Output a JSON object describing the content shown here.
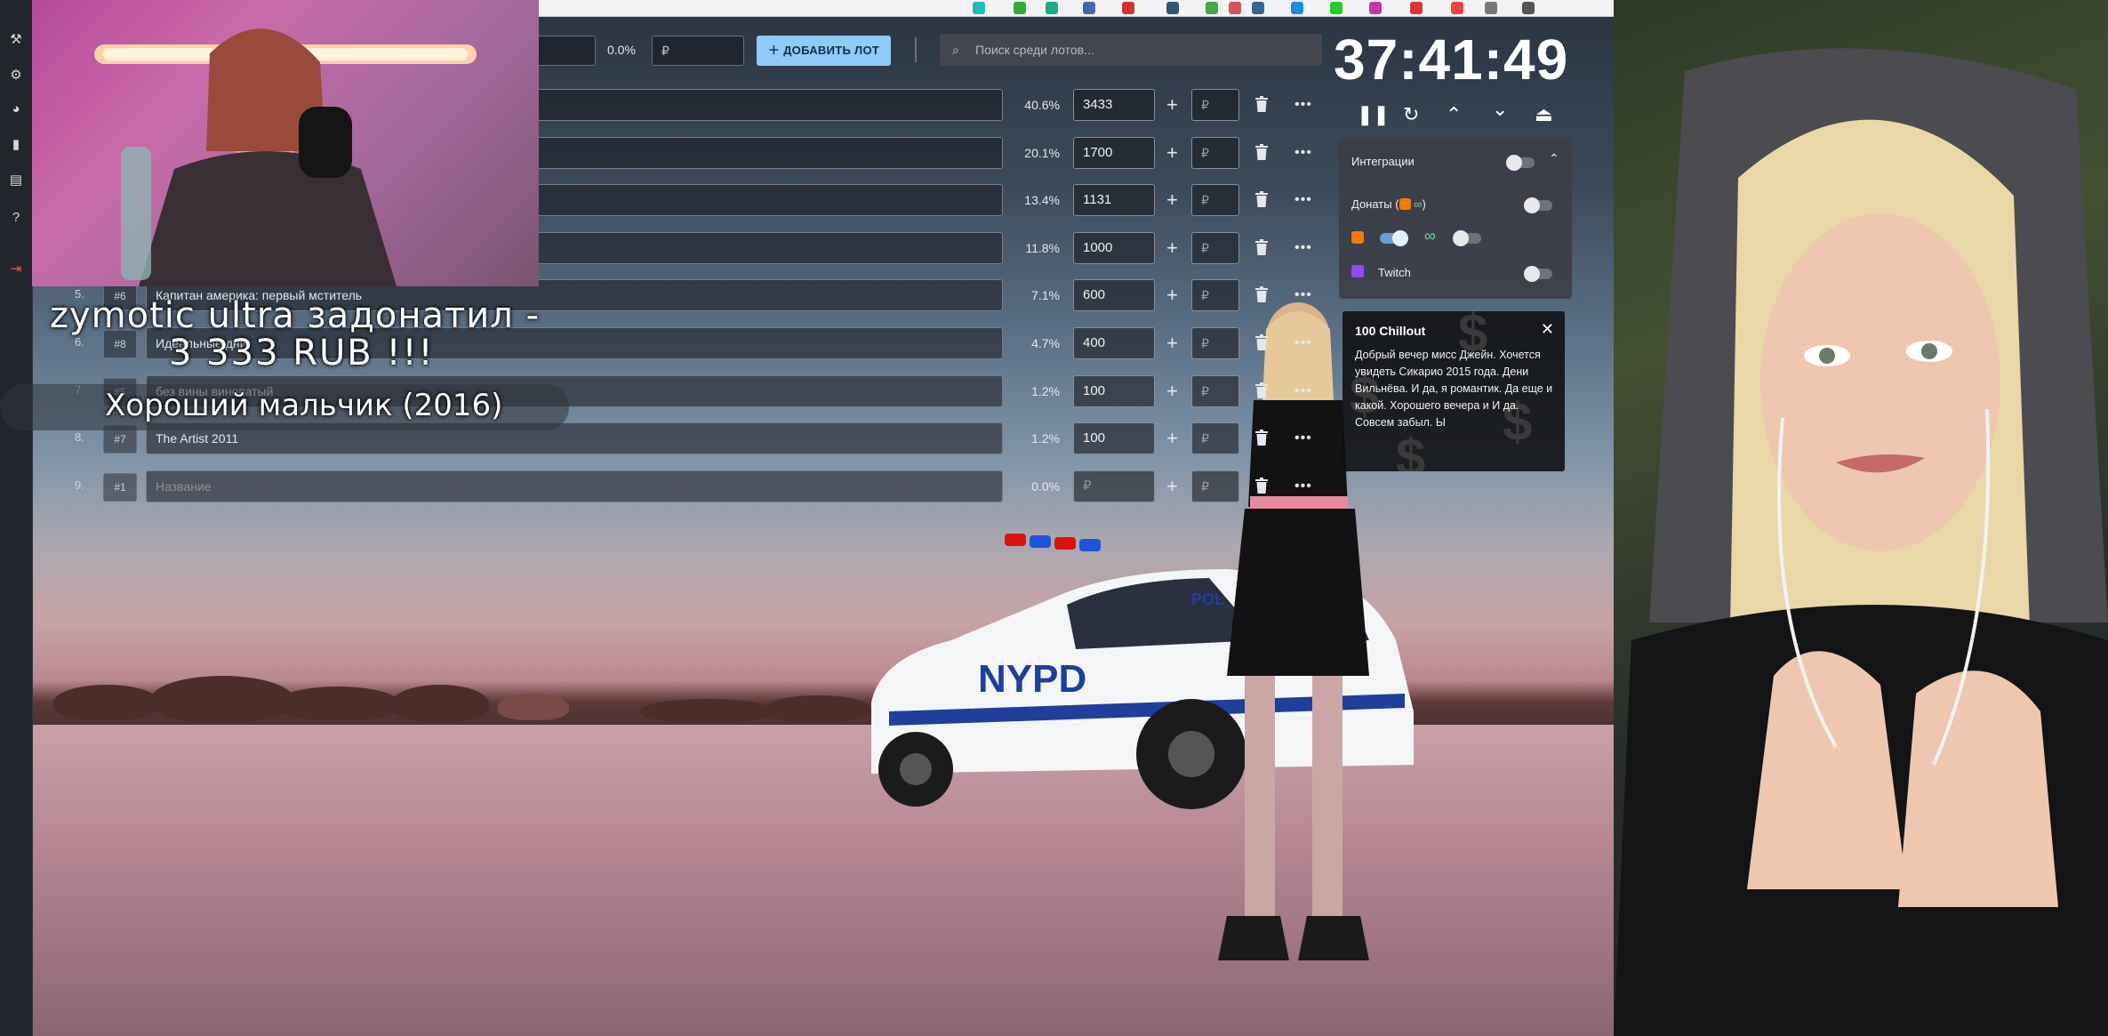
{
  "toolbar": {
    "total_percent": "0.0%",
    "amount_placeholder": "₽",
    "add_lot_label": "ДОБАВИТЬ ЛОТ",
    "search_placeholder": "Поиск среди лотов..."
  },
  "lots": [
    {
      "num": "",
      "id": "",
      "name": "",
      "percent": "40.6%",
      "amount": "3433",
      "add_placeholder": "₽"
    },
    {
      "num": "",
      "id": "",
      "name": "",
      "percent": "20.1%",
      "amount": "1700",
      "add_placeholder": "₽"
    },
    {
      "num": "",
      "id": "",
      "name": "",
      "percent": "13.4%",
      "amount": "1131",
      "add_placeholder": "₽"
    },
    {
      "num": "",
      "id": "",
      "name": "",
      "percent": "11.8%",
      "amount": "1000",
      "add_placeholder": "₽"
    },
    {
      "num": "5.",
      "id": "#6",
      "name": "Капитан америка: первый мститель",
      "percent": "7.1%",
      "amount": "600",
      "add_placeholder": "₽"
    },
    {
      "num": "6.",
      "id": "#8",
      "name": "Идеальные дни",
      "percent": "4.7%",
      "amount": "400",
      "add_placeholder": "₽"
    },
    {
      "num": "7.",
      "id": "#5",
      "name": "без вины виноватый",
      "percent": "1.2%",
      "amount": "100",
      "add_placeholder": "₽"
    },
    {
      "num": "8.",
      "id": "#7",
      "name": "The Artist 2011",
      "percent": "1.2%",
      "amount": "100",
      "add_placeholder": "₽"
    },
    {
      "num": "9.",
      "id": "#1",
      "name_placeholder": "Название",
      "percent": "0.0%",
      "amount_placeholder": "₽",
      "add_placeholder": "₽"
    }
  ],
  "timer": {
    "value": "37:41:49"
  },
  "integrations": {
    "title": "Интеграции",
    "donations_label": "Донаты (",
    "donations_suffix": ")",
    "twitch_label": "Twitch"
  },
  "donation": {
    "header": "100 Chillout",
    "message": "Добрый вечер мисс Джейн. Хочется увидеть Сикарио 2015 года. Дени Вильнёва. И да, я романтик. Да еще и какой. Хорошего вечера и И да. Совсем забыл. Ы"
  },
  "overlay": {
    "donor_line": "zymotic ultra задонатил -",
    "amount_line": "3 333 RUB !!!",
    "movie_line": "Хороший мальчик (2016)"
  },
  "colors": {
    "add_button": "#90caf9",
    "toggle_on": "#6a9dd6",
    "donation_alerts": "#f57c00",
    "twitch": "#9146ff"
  }
}
